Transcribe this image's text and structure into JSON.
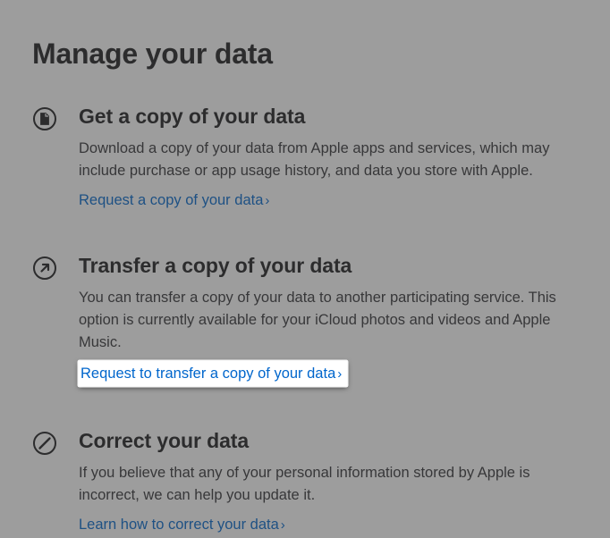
{
  "page": {
    "title": "Manage your data"
  },
  "sections": {
    "copy": {
      "heading": "Get a copy of your data",
      "desc": "Download a copy of your data from Apple apps and services, which may include purchase or app usage history, and data you store with Apple.",
      "link": "Request a copy of your data",
      "chev": "›"
    },
    "transfer": {
      "heading": "Transfer a copy of your data",
      "desc": "You can transfer a copy of your data to another participating service. This option is currently available for your iCloud photos and videos and Apple Music.",
      "link": "Request to transfer a copy of your data",
      "chev": "›"
    },
    "correct": {
      "heading": "Correct your data",
      "desc": "If you believe that any of your personal information stored by Apple is incorrect, we can help you update it.",
      "link": "Learn how to correct your data",
      "chev": "›"
    }
  }
}
